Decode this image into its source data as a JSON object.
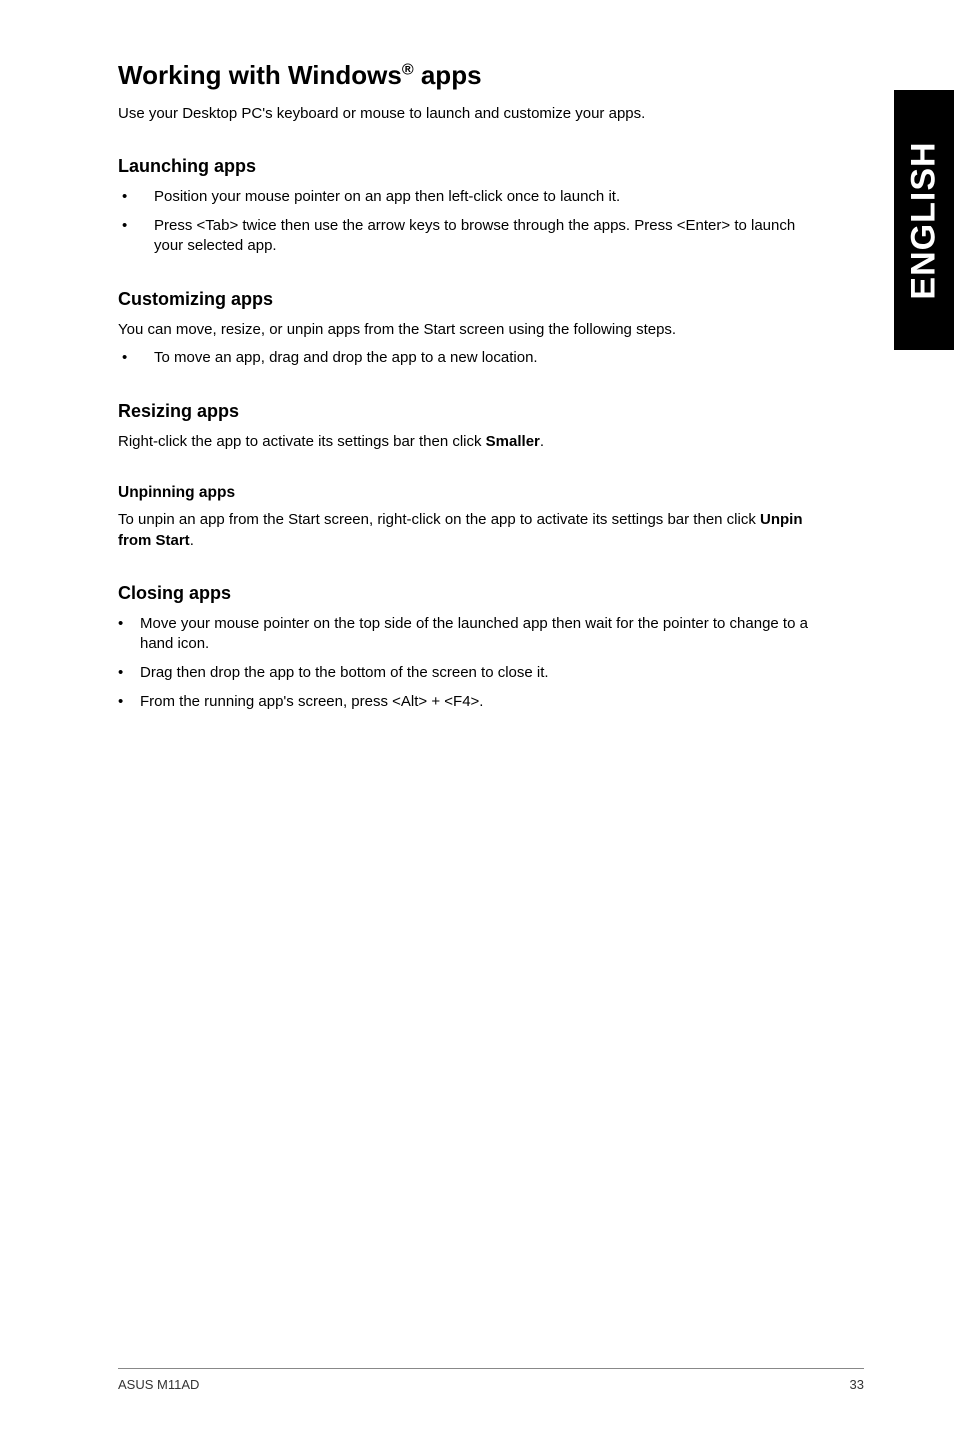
{
  "sideTab": "ENGLISH",
  "title": {
    "pre": "Working with Windows",
    "reg": "®",
    "post": " apps"
  },
  "intro": "Use your Desktop PC's keyboard or mouse to launch and customize your apps.",
  "launching": {
    "heading": "Launching apps",
    "items": [
      "Position your mouse pointer on an app then left-click once to launch it.",
      "Press <Tab> twice then use the arrow keys to browse through the apps. Press <Enter> to launch your selected app."
    ]
  },
  "customizing": {
    "heading": "Customizing apps",
    "desc": "You can move, resize, or unpin apps from the Start screen using the following steps.",
    "items": [
      "To move an app, drag and drop the app to a new location."
    ]
  },
  "resizing": {
    "heading": "Resizing apps",
    "desc_pre": "Right-click the app to activate its settings bar then click ",
    "desc_bold": "Smaller",
    "desc_post": "."
  },
  "unpinning": {
    "heading": "Unpinning apps",
    "desc_pre": "To unpin an app from the Start screen, right-click on the app to activate its settings bar then click ",
    "desc_bold": "Unpin from Start",
    "desc_post": "."
  },
  "closing": {
    "heading": "Closing apps",
    "items": [
      "Move your mouse pointer on the top side of the launched app then wait for the pointer to change to a hand icon.",
      "Drag then drop the app to the bottom of the screen to close it.",
      "From the running app's screen, press <Alt> + <F4>."
    ]
  },
  "footer": {
    "left": "ASUS M11AD",
    "right": "33"
  }
}
